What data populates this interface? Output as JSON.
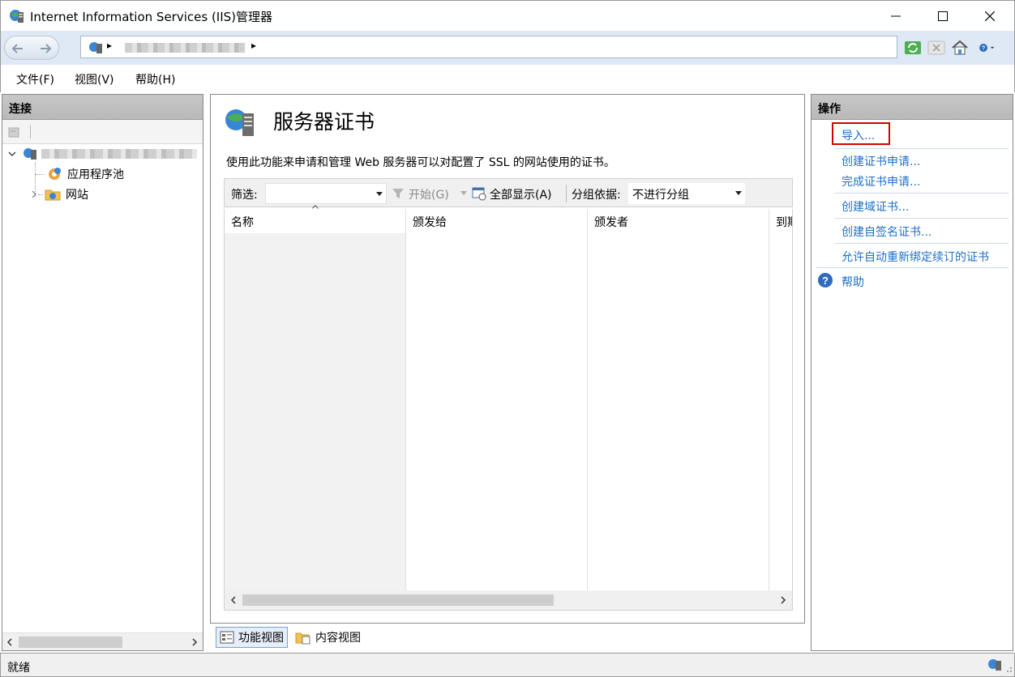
{
  "window": {
    "title": "Internet Information Services (IIS)管理器",
    "minimize_glyph": "—",
    "maximize_glyph": "☐",
    "close_glyph": "✕"
  },
  "address": {
    "separator": "▸"
  },
  "menu": [
    "文件(F)",
    "视图(V)",
    "帮助(H)"
  ],
  "connections": {
    "header": "连接",
    "tree": {
      "app_pools": "应用程序池",
      "sites": "网站"
    }
  },
  "main": {
    "title": "服务器证书",
    "description": "使用此功能来申请和管理 Web 服务器可以对配置了 SSL 的网站使用的证书。",
    "filter": {
      "label": "筛选:",
      "start": "开始(G)",
      "show_all": "全部显示(A)",
      "group_by_label": "分组依据:",
      "group_by_value": "不进行分组"
    },
    "columns": [
      "名称",
      "颁发给",
      "颁发者",
      "到期"
    ],
    "sort_indicator": "^"
  },
  "view_tabs": {
    "features": "功能视图",
    "content": "内容视图"
  },
  "actions": {
    "header": "操作",
    "import": "导入...",
    "create_request": "创建证书申请...",
    "complete_request": "完成证书申请...",
    "create_domain": "创建域证书...",
    "create_self_signed": "创建自签名证书...",
    "auto_rebind": "允许自动重新绑定续订的证书",
    "help": "帮助"
  },
  "status": {
    "text": "就绪"
  },
  "colors": {
    "link": "#1e6fc7",
    "highlight_box": "#d40000",
    "panel_header": "#bfbfbf",
    "address_bar": "#dfe9f5"
  }
}
